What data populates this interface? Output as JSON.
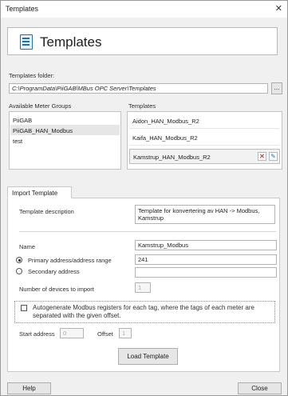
{
  "window": {
    "title": "Templates"
  },
  "header": {
    "title": "Templates"
  },
  "templates_folder": {
    "label": "Templates folder:",
    "value": "C:\\ProgramData\\PiiGAB\\MBus OPC Server\\Templates",
    "browse_label": "..."
  },
  "meter_groups": {
    "label": "Available Meter Groups",
    "items": [
      "PiiGAB",
      "PiiGAB_HAN_Modbus",
      "test"
    ]
  },
  "templates": {
    "label": "Templates",
    "items": [
      "Aidon_HAN_Modbus_R2",
      "Kaifa_HAN_Modbus_R2",
      "Kamstrup_HAN_Modbus_R2"
    ]
  },
  "import": {
    "tab_label": "Import Template",
    "description_label": "Template description",
    "description_value": "Template for konvertering av HAN -> Modbus, Kamstrup",
    "name_label": "Name",
    "name_value": "Kamstrup_Modbus",
    "primary_label": "Primary address/address range",
    "primary_value": "241",
    "secondary_label": "Secondary address",
    "secondary_value": "",
    "devices_label": "Number of devices to import",
    "devices_value": "1",
    "autogen_label": "Autogenerate Modbus registers for each tag, where the tags of each meter are separated with the given offset.",
    "start_label": "Start address",
    "start_value": "0",
    "offset_label": "Offset",
    "offset_value": "1",
    "load_button": "Load Template"
  },
  "footer": {
    "help": "Help",
    "close": "Close"
  },
  "colors": {
    "accent": "#1f6fbd",
    "delete": "#d63a3a"
  },
  "icons": {
    "header": "document-list-icon",
    "delete": "delete-x-icon",
    "edit": "edit-icon"
  }
}
